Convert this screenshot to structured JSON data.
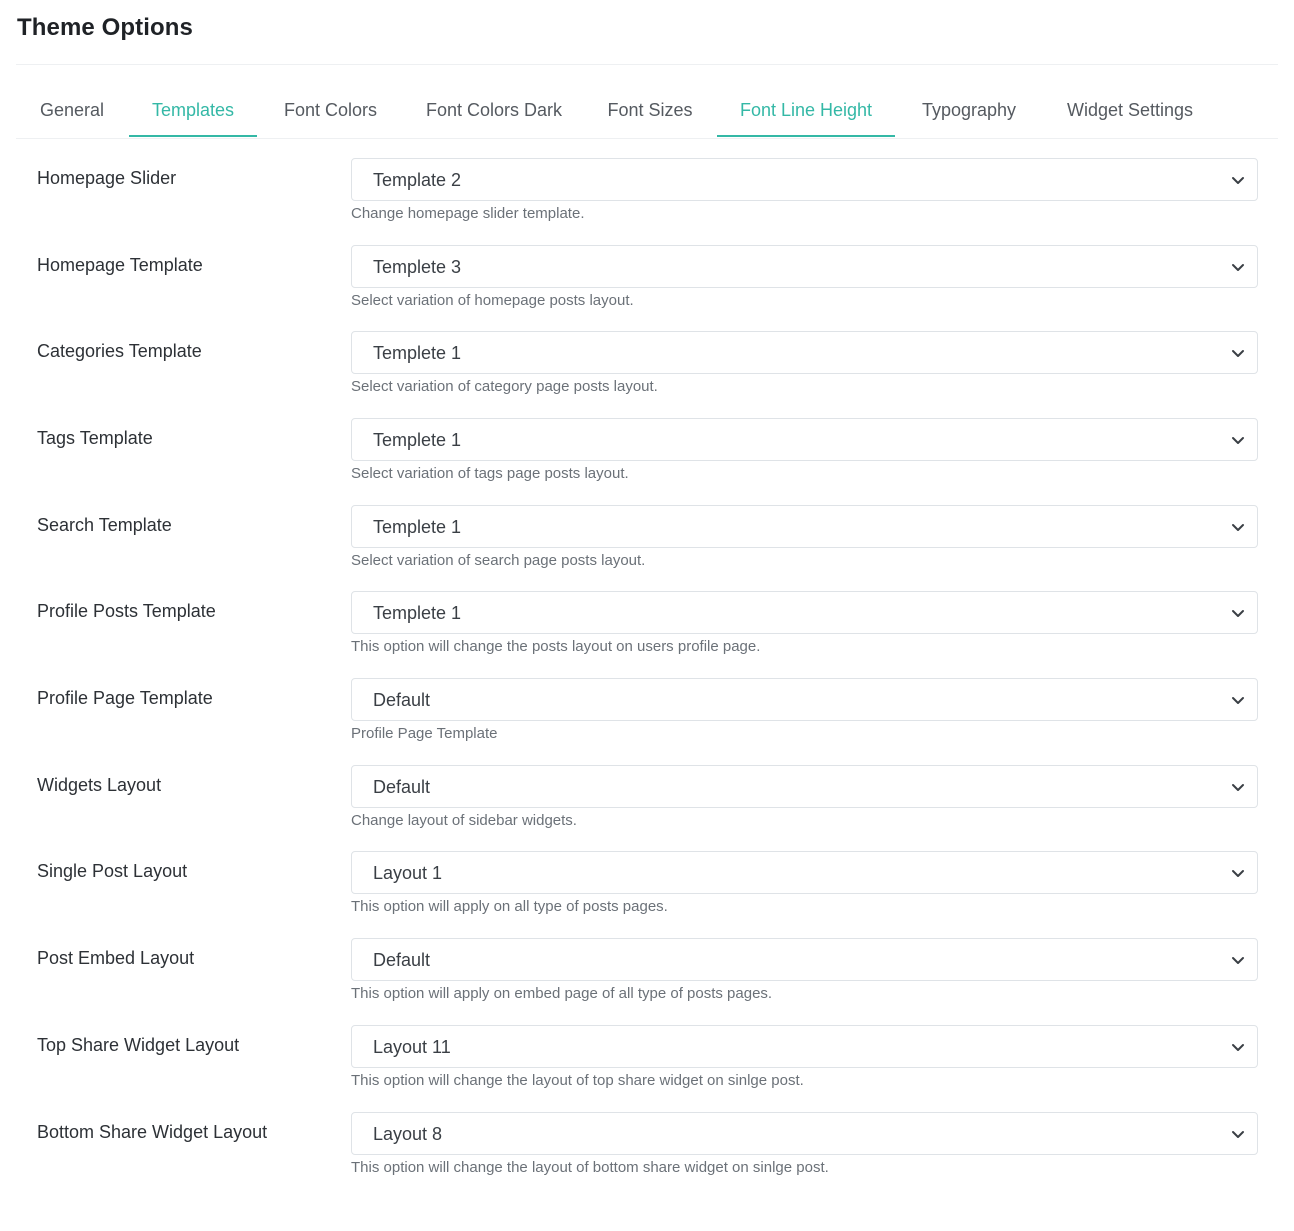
{
  "page": {
    "title": "Theme Options"
  },
  "tabs": [
    {
      "label": "General",
      "active": false
    },
    {
      "label": "Templates",
      "active": true
    },
    {
      "label": "Font Colors",
      "active": false
    },
    {
      "label": "Font Colors Dark",
      "active": false
    },
    {
      "label": "Font Sizes",
      "active": false
    },
    {
      "label": "Font Line Height",
      "active": true
    },
    {
      "label": "Typography",
      "active": false
    },
    {
      "label": "Widget Settings",
      "active": false
    }
  ],
  "colors": {
    "accent": "#34b8a6",
    "text": "#2d3136",
    "muted": "#6b7178",
    "border": "#dfe3e7"
  },
  "fields": [
    {
      "label": "Homepage Slider",
      "value": "Template 2",
      "help": "Change homepage slider template."
    },
    {
      "label": "Homepage Template",
      "value": "Templete 3",
      "help": "Select variation of homepage posts layout."
    },
    {
      "label": "Categories Template",
      "value": "Templete 1",
      "help": "Select variation of category page posts layout."
    },
    {
      "label": "Tags Template",
      "value": "Templete 1",
      "help": "Select variation of tags page posts layout."
    },
    {
      "label": "Search Template",
      "value": "Templete 1",
      "help": "Select variation of search page posts layout."
    },
    {
      "label": "Profile Posts Template",
      "value": "Templete 1",
      "help": "This option will change the posts layout on users profile page."
    },
    {
      "label": "Profile Page Template",
      "value": "Default",
      "help": "Profile Page Template"
    },
    {
      "label": "Widgets Layout",
      "value": "Default",
      "help": "Change layout of sidebar widgets."
    },
    {
      "label": "Single Post Layout",
      "value": "Layout 1",
      "help": "This option will apply on all type of posts pages."
    },
    {
      "label": "Post Embed Layout",
      "value": "Default",
      "help": "This option will apply on embed page of all type of posts pages."
    },
    {
      "label": "Top Share Widget Layout",
      "value": "Layout 11",
      "help": "This option will change the layout of top share widget on sinlge post."
    },
    {
      "label": "Bottom Share Widget Layout",
      "value": "Layout 8",
      "help": "This option will change the layout of bottom share widget on sinlge post."
    }
  ],
  "icons": {
    "select_arrow": "chevron-down-icon"
  }
}
